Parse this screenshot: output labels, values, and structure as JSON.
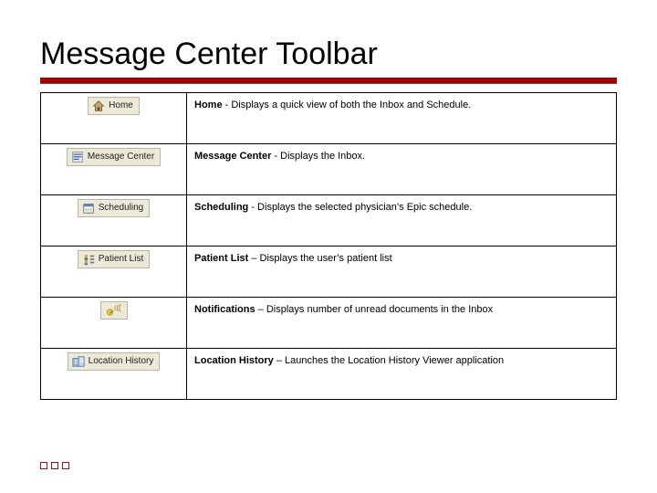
{
  "title": "Message Center Toolbar",
  "rows": [
    {
      "button_label": "Home",
      "icon": "home-icon",
      "desc_bold": "Home",
      "desc_rest": " - Displays a quick view of both the Inbox and Schedule."
    },
    {
      "button_label": "Message Center",
      "icon": "message-center-icon",
      "desc_bold": "Message Center",
      "desc_rest": " - Displays the Inbox."
    },
    {
      "button_label": "Scheduling",
      "icon": "scheduling-icon",
      "desc_bold": "Scheduling",
      "desc_rest": " - Displays the selected physician’s Epic schedule."
    },
    {
      "button_label": "Patient List",
      "icon": "patient-list-icon",
      "desc_bold": "Patient List",
      "desc_rest": " – Displays the user’s patient list"
    },
    {
      "button_label": "",
      "icon": "notifications-icon",
      "desc_bold": "Notifications",
      "desc_rest": " – Displays number of unread documents in the Inbox"
    },
    {
      "button_label": "Location History",
      "icon": "location-history-icon",
      "desc_bold": "Location History",
      "desc_rest": " – Launches the Location History Viewer application"
    }
  ]
}
